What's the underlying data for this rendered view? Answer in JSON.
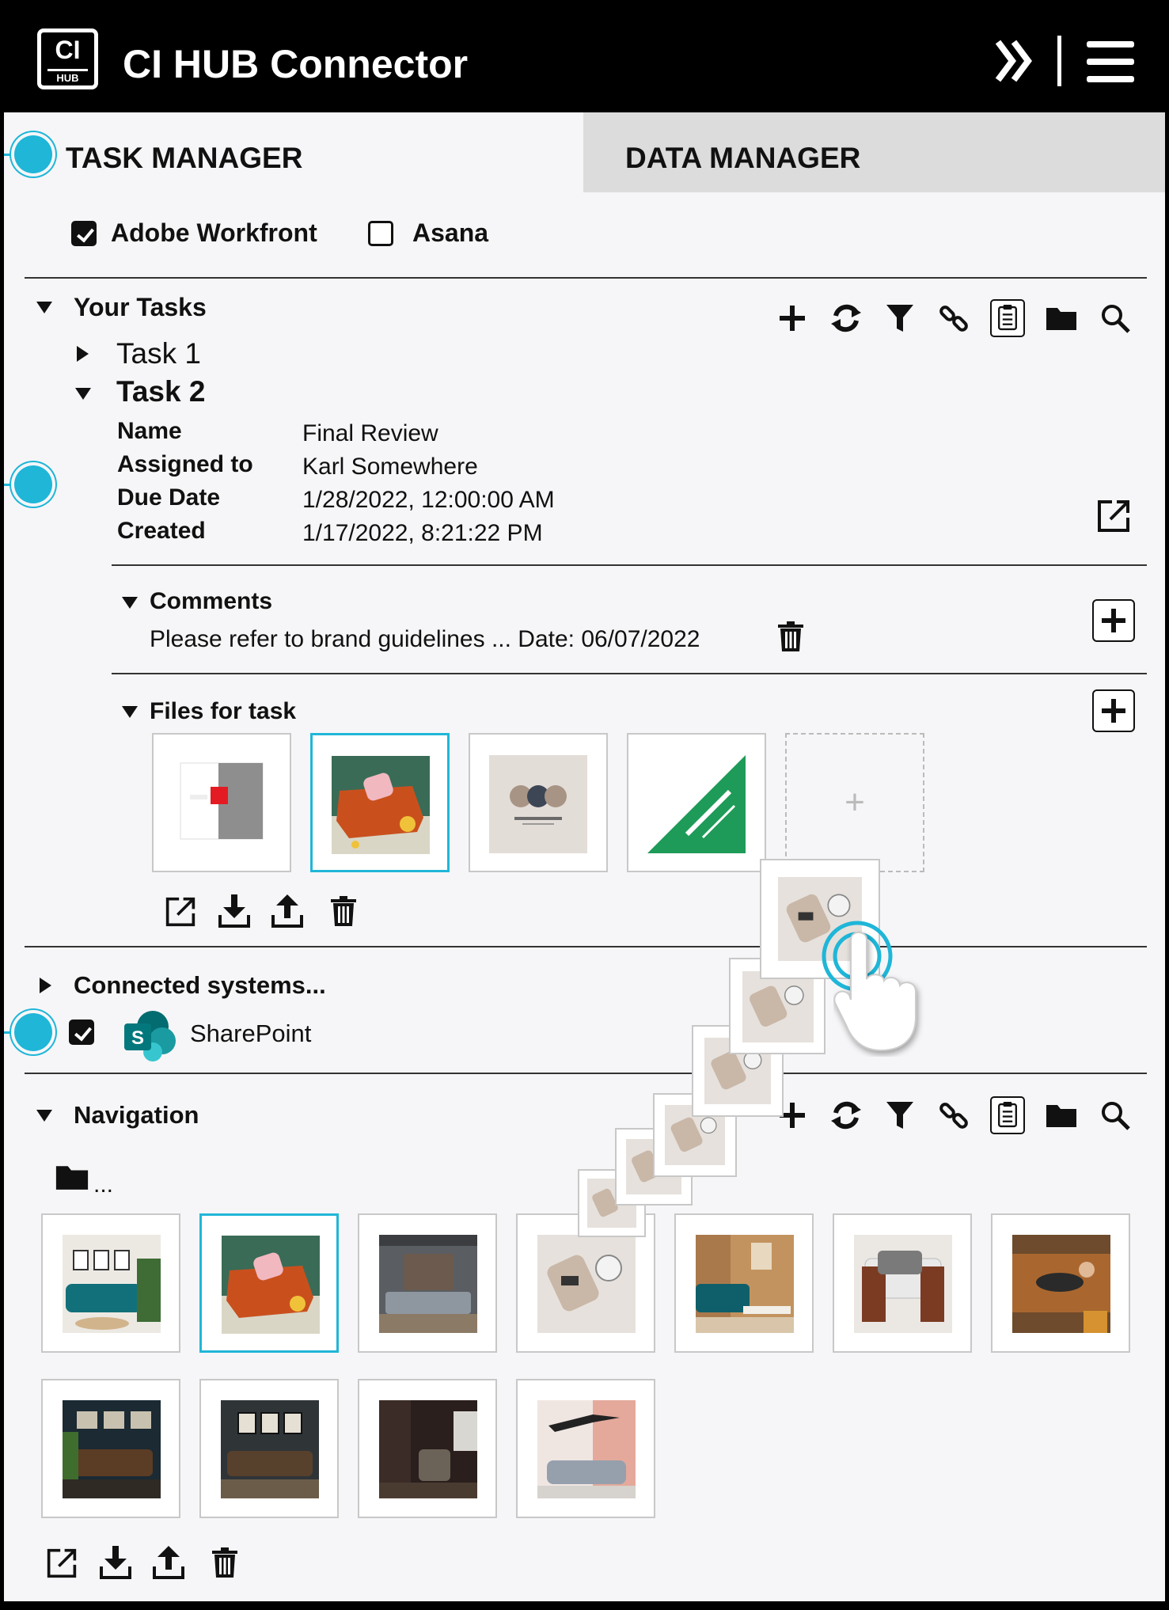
{
  "header": {
    "logo_top": "CI",
    "logo_bottom": "HUB",
    "title": "CI HUB Connector",
    "icons": [
      "double-chevron-right-icon",
      "hamburger-menu-icon"
    ]
  },
  "tabs": [
    {
      "label": "TASK MANAGER",
      "active": true
    },
    {
      "label": "DATA MANAGER",
      "active": false
    }
  ],
  "systems": [
    {
      "label": "Adobe Workfront",
      "checked": true
    },
    {
      "label": "Asana",
      "checked": false
    }
  ],
  "your_tasks": {
    "title": "Your Tasks",
    "toolbar_icons": [
      "plus-icon",
      "sync-icon",
      "filter-icon",
      "link-icon",
      "clipboard-icon",
      "folder-icon",
      "search-icon"
    ],
    "tasks": [
      {
        "label": "Task 1",
        "expanded": false
      },
      {
        "label": "Task 2",
        "expanded": true
      }
    ],
    "details": [
      {
        "key": "Name",
        "value": "Final Review"
      },
      {
        "key": "Assigned to",
        "value": "Karl Somewhere"
      },
      {
        "key": "Due Date",
        "value": "1/28/2022, 12:00:00 AM"
      },
      {
        "key": "Created",
        "value": "1/17/2022, 8:21:22 PM"
      }
    ],
    "comments": {
      "title": "Comments",
      "text": "Please refer to brand guidelines ... Date: 06/07/2022"
    },
    "files": {
      "title": "Files for task",
      "items": [
        "document-thumbnail",
        "orange-sofa-thumbnail",
        "furniture-logo-thumbnail",
        "early-bird-thumbnail"
      ],
      "add_placeholder": "+",
      "actions": [
        "open-external-icon",
        "download-icon",
        "upload-icon",
        "trash-icon"
      ]
    }
  },
  "connected": {
    "title": "Connected systems...",
    "item": {
      "label": "SharePoint",
      "checked": true
    }
  },
  "navigation": {
    "title": "Navigation",
    "folder_label": "...",
    "toolbar_icons": [
      "plus-icon",
      "sync-icon",
      "filter-icon",
      "link-icon",
      "clipboard-icon",
      "folder-icon",
      "search-icon"
    ],
    "images_row1": [
      "teal-sofa-room",
      "orange-sofa",
      "brick-wall-living-room",
      "chair-top-view",
      "teal-sofa-wood-wall",
      "wooden-armchair",
      "woman-on-sofa"
    ],
    "images_row2": [
      "dark-gallery-sofa",
      "framed-pictures-sofa",
      "dark-armchair",
      "jumping-person-sofa"
    ],
    "actions": [
      "open-external-icon",
      "download-icon",
      "upload-icon",
      "trash-icon"
    ]
  },
  "colors": {
    "accent": "#1fb6d8",
    "header_bg": "#000000",
    "page_bg": "#f6f6f8",
    "inactive_tab": "#dcdcdc"
  }
}
